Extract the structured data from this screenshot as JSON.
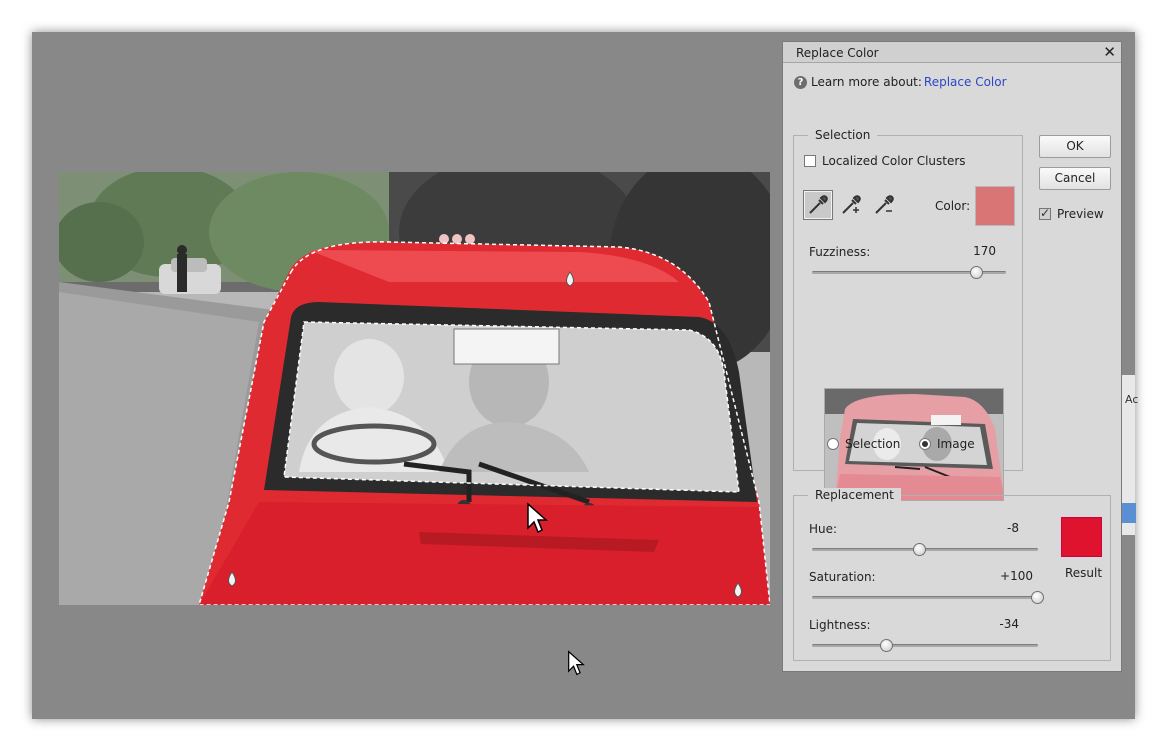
{
  "dialog": {
    "title": "Replace Color",
    "close_icon": "close-icon",
    "help_prefix": "Learn more about:",
    "help_link": "Replace Color"
  },
  "buttons": {
    "ok": "OK",
    "cancel": "Cancel",
    "preview_label": "Preview",
    "preview_checked": true
  },
  "selection": {
    "group_label": "Selection",
    "localized_label": "Localized Color Clusters",
    "localized_checked": false,
    "tools": [
      "eyedropper-icon",
      "eyedropper-plus-icon",
      "eyedropper-minus-icon"
    ],
    "active_tool": "eyedropper-icon",
    "color_label": "Color:",
    "color_value": "#d97574",
    "fuzziness_label": "Fuzziness:",
    "fuzziness_value": "170",
    "fuzziness_fraction": 0.85,
    "radio_selection_label": "Selection",
    "radio_image_label": "Image",
    "selected_radio": "Image"
  },
  "replacement": {
    "group_label": "Replacement",
    "hue_label": "Hue:",
    "hue_value": "-8",
    "hue_fraction": 0.48,
    "saturation_label": "Saturation:",
    "saturation_value": "+100",
    "saturation_fraction": 1.0,
    "lightness_label": "Lightness:",
    "lightness_value": "-34",
    "lightness_fraction": 0.33,
    "result_label": "Result",
    "result_color": "#e0132f"
  },
  "side_panel": {
    "partial_label": "Ac"
  }
}
